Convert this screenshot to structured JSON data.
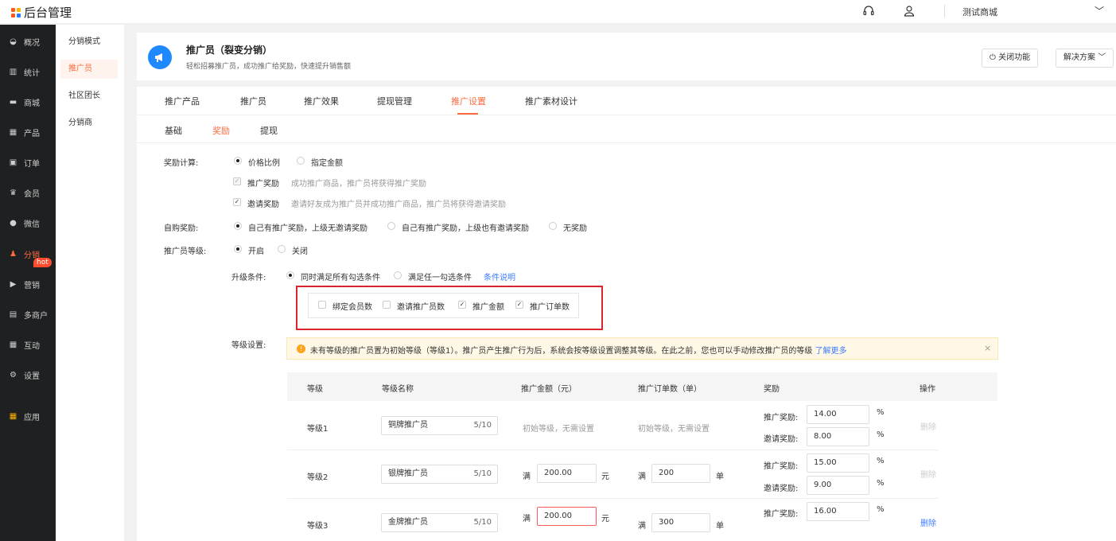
{
  "header": {
    "app_title": "后台管理",
    "shop_name": "测试商城",
    "logo_colors": [
      "#ff5a1f",
      "#ffb400",
      "#ff5a1f",
      "#2a7bff"
    ]
  },
  "nav_primary": {
    "items": [
      {
        "label": "概况",
        "icon": "gauge-icon"
      },
      {
        "label": "统计",
        "icon": "chart-icon"
      },
      {
        "label": "商城",
        "icon": "shop-icon"
      },
      {
        "label": "产品",
        "icon": "grid-icon"
      },
      {
        "label": "订单",
        "icon": "order-icon"
      },
      {
        "label": "会员",
        "icon": "crown-icon"
      },
      {
        "label": "微信",
        "icon": "wechat-icon"
      },
      {
        "label": "分销",
        "icon": "distribution-icon"
      },
      {
        "label": "营销",
        "icon": "flag-icon"
      },
      {
        "label": "多商户",
        "icon": "merchant-icon"
      },
      {
        "label": "互动",
        "icon": "interact-icon"
      },
      {
        "label": "设置",
        "icon": "gear-icon"
      },
      {
        "label": "应用",
        "icon": "apps-icon"
      }
    ],
    "hot_badge": "hot"
  },
  "nav_secondary": {
    "items": [
      "分销模式",
      "推广员",
      "社区团长",
      "分销商"
    ]
  },
  "page_header": {
    "title": "推广员（裂变分销）",
    "desc": "轻松招募推广员，成功推广给奖励，快速提升销售额",
    "close_btn": "关闭功能",
    "solution_btn": "解决方案"
  },
  "tabs": [
    "推广产品",
    "推广员",
    "推广效果",
    "提现管理",
    "推广设置",
    "推广素材设计"
  ],
  "subtabs": [
    "基础",
    "奖励",
    "提现"
  ],
  "form": {
    "reward_calc": {
      "label": "奖励计算:",
      "options": [
        "价格比例",
        "指定金额"
      ],
      "promo_reward": {
        "label": "推广奖励",
        "desc": "成功推广商品，推广员将获得推广奖励"
      },
      "invite_reward": {
        "label": "邀请奖励",
        "desc": "邀请好友成为推广员并成功推广商品，推广员将获得邀请奖励"
      }
    },
    "self_purchase": {
      "label": "自购奖励:",
      "options": [
        "自己有推广奖励，上级无邀请奖励",
        "自己有推广奖励，上级也有邀请奖励",
        "无奖励"
      ]
    },
    "level": {
      "label": "推广员等级:",
      "options": [
        "开启",
        "关闭"
      ]
    },
    "upgrade": {
      "label": "升级条件:",
      "options": [
        "同时满足所有勾选条件",
        "满足任一勾选条件"
      ],
      "link": "条件说明",
      "conditions": [
        {
          "label": "绑定会员数",
          "checked": false
        },
        {
          "label": "邀请推广员数",
          "checked": false
        },
        {
          "label": "推广金额",
          "checked": true
        },
        {
          "label": "推广订单数",
          "checked": true
        }
      ]
    },
    "level_setting": {
      "label": "等级设置:",
      "alert": "未有等级的推广员置为初始等级（等级1）。推广员产生推广行为后，系统会按等级设置调整其等级。在此之前，您也可以手动修改推广员的等级",
      "alert_link": "了解更多",
      "alert_close": "×"
    }
  },
  "table": {
    "headers": [
      "等级",
      "等级名称",
      "推广金额（元）",
      "推广订单数（单）",
      "奖励",
      "操作"
    ],
    "rows": [
      {
        "level": "等级1",
        "name": "铜牌推广员",
        "count": "5/10",
        "amount_text": "初始等级，无需设置",
        "orders_text": "初始等级，无需设置",
        "promo": "14.00",
        "invite": "8.00",
        "action": "删除"
      },
      {
        "level": "等级2",
        "name": "银牌推广员",
        "count": "5/10",
        "amount_prefix": "满",
        "amount": "200.00",
        "amount_unit": "元",
        "orders_prefix": "满",
        "orders": "200",
        "orders_unit": "单",
        "promo": "15.00",
        "invite": "9.00",
        "action": "删除"
      },
      {
        "level": "等级3",
        "name": "金牌推广员",
        "count": "5/10",
        "amount_prefix": "满",
        "amount": "200.00",
        "amount_unit": "元",
        "orders_prefix": "满",
        "orders": "300",
        "orders_unit": "单",
        "promo": "16.00",
        "invite": "",
        "action": "删除"
      }
    ],
    "promo_label": "推广奖励:",
    "invite_label": "邀请奖励:",
    "percent": "%"
  }
}
